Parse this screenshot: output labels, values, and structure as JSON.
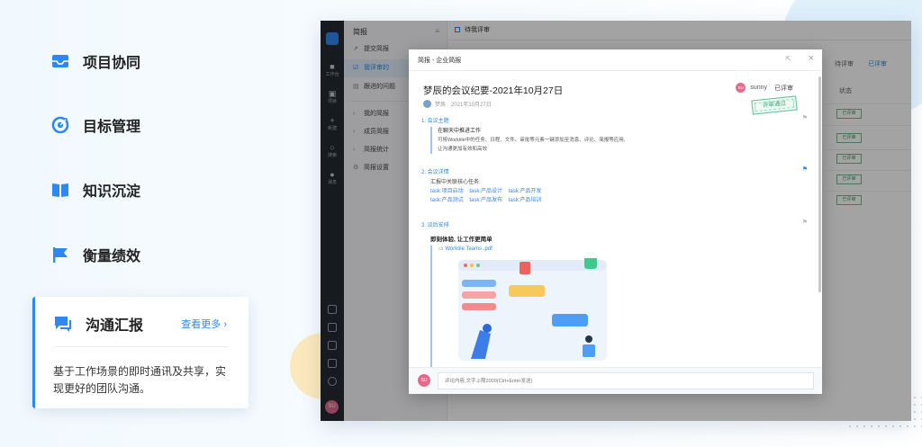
{
  "features": [
    {
      "label": "项目协同",
      "icon": "inbox-icon"
    },
    {
      "label": "目标管理",
      "icon": "target-icon"
    },
    {
      "label": "知识沉淀",
      "icon": "book-icon"
    },
    {
      "label": "衡量绩效",
      "icon": "flag-icon"
    }
  ],
  "active_feature": {
    "label": "沟通汇报",
    "icon": "chat-icon",
    "more_link": "查看更多",
    "description": "基于工作场景的即时通讯及共享，实现更好的团队沟通。"
  },
  "app": {
    "rail": {
      "items": [
        "工作台",
        "项目",
        "新建",
        "搜索",
        "消息"
      ],
      "user_initials": "SU"
    },
    "sidebar": {
      "title": "简报",
      "items": [
        "提交简报",
        "我评审的",
        "跟进的问题",
        "我的简报",
        "成员简报",
        "简报统计",
        "简报设置"
      ],
      "active_index": 1
    },
    "main": {
      "header": "待我评审",
      "tabs": [
        "待评审",
        "已评审"
      ],
      "status_header": "状态",
      "status_values": [
        "已评审",
        "已评审",
        "已评审",
        "已评审",
        "已评审"
      ]
    },
    "modal": {
      "title": "简报 - 企业简报",
      "doc_title": "梦辰的会议纪要-2021年10月27日",
      "author": "梦辰",
      "date": "2021年10月27日",
      "reviewer": {
        "initials": "SU",
        "name": "sunny",
        "status": "已评审"
      },
      "stamp": "评审通过",
      "sections": [
        {
          "title": "1. 会议主题",
          "head": "在聊天中推进工作",
          "lines": [
            "可将Worktile中的任务、日程、文件、审批等元素一键添加至消息、评论、简报等应用,",
            "让沟通更加有效和高效"
          ]
        },
        {
          "title": "2. 会议详情",
          "head": "汇报中关联核心任务:",
          "tasks": [
            "task:项目启动",
            "task:产品设计",
            "task:产品开发",
            "task:产品测试",
            "task:产品发布",
            "task:产品培训"
          ]
        },
        {
          "title": "3. 议后安排",
          "head": "即刻体验, 让工作更简单",
          "attachment": "Worktile Teams .pdf"
        }
      ],
      "comment": {
        "initials": "SU",
        "placeholder": "评论内容,文字上限2000(Ctrl+Enter发送)"
      }
    }
  },
  "colors": {
    "accent": "#2f88f0",
    "rail": "#24292f",
    "stamp": "#3aa87b"
  }
}
